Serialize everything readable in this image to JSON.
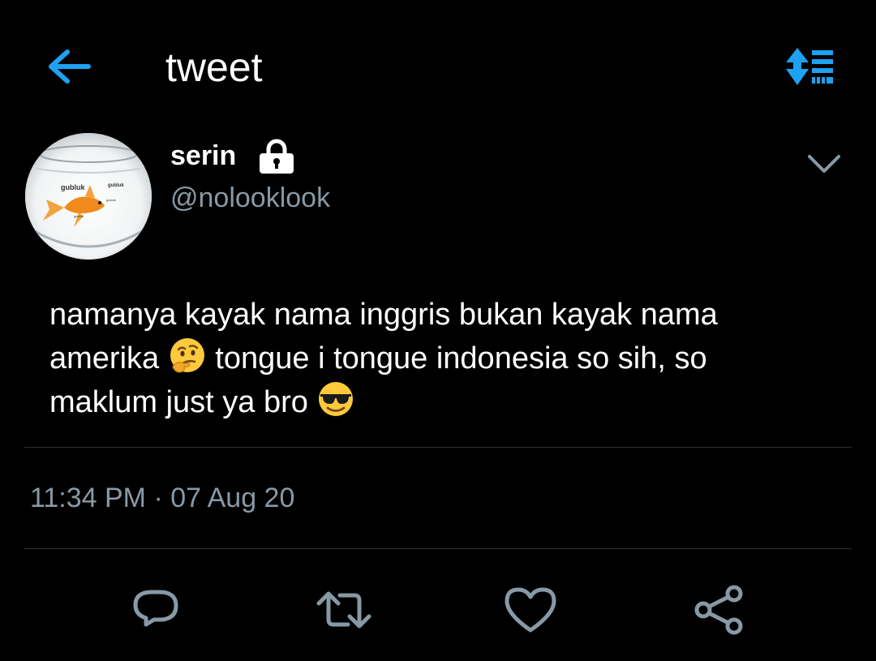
{
  "header": {
    "title": "tweet",
    "back_icon": "arrow-left-icon",
    "sort_icon": "sort-list-icon"
  },
  "author": {
    "name": "serin",
    "handle": "@nolooklook",
    "protected_icon": "lock-icon",
    "avatar_labels": [
      "gubluk",
      "gubluk",
      "gubluk",
      "gubluk"
    ]
  },
  "tweet": {
    "line1": "namanya kayak nama inggris bukan kayak nama",
    "line2a": "amerika",
    "emoji1": "thinking-face-emoji",
    "line2b": "tongue i tongue indonesia so sih, so",
    "line3": "maklum just ya bro",
    "emoji2": "sunglasses-face-emoji"
  },
  "meta": {
    "timestamp": "11:34 PM · 07 Aug 20"
  },
  "actions": [
    "reply-icon",
    "retweet-icon",
    "like-icon",
    "share-icon"
  ],
  "colors": {
    "background": "#000000",
    "accent": "#1da1f2",
    "muted": "#8899a6",
    "divider": "#2f3336"
  }
}
